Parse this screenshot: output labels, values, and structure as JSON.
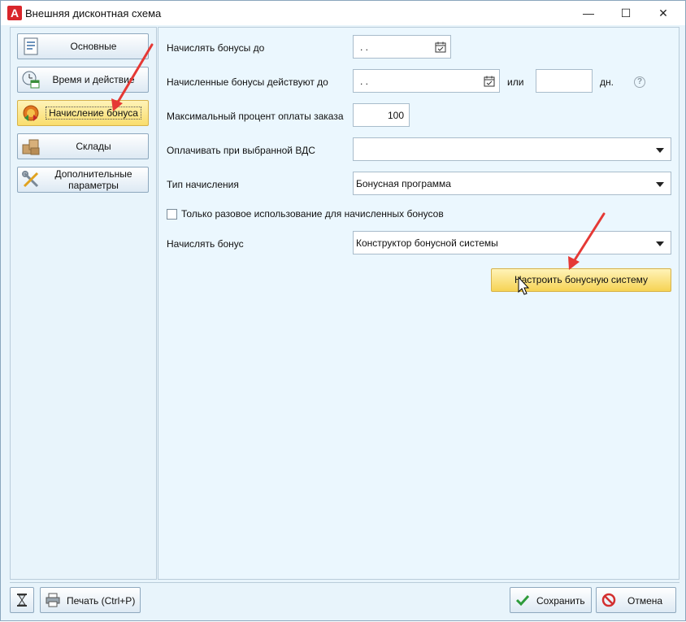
{
  "window": {
    "title": "Внешняя дисконтная схема",
    "icon_letter": "A",
    "minimize_glyph": "—",
    "maximize_glyph": "☐",
    "close_glyph": "✕"
  },
  "sidebar": {
    "items": [
      {
        "label": "Основные",
        "icon": "document-icon",
        "active": false
      },
      {
        "label": "Время и действие",
        "icon": "clock-calendar-icon",
        "active": false
      },
      {
        "label": "Начисление бонуса",
        "icon": "bonus-badge-icon",
        "active": true
      },
      {
        "label": "Склады",
        "icon": "boxes-icon",
        "active": false
      },
      {
        "label": "Дополнительные параметры",
        "icon": "tools-icon",
        "active": false
      }
    ]
  },
  "form": {
    "accrue_until_label": "Начислять бонусы до",
    "accrue_until_value": ". .",
    "valid_until_label": "Начисленные бонусы действуют до",
    "valid_until_value": ". .",
    "or_label": "или",
    "days_value": "",
    "days_unit": "дн.",
    "help_glyph": "?",
    "max_percent_label": "Максимальный процент оплаты заказа",
    "max_percent_value": "100",
    "pay_vds_label": "Оплачивать при выбранной ВДС",
    "pay_vds_value": "",
    "accrual_type_label": "Тип начисления",
    "accrual_type_value": "Бонусная программа",
    "one_time_label": "Только разовое использование для начисленных бонусов",
    "one_time_checked": false,
    "accrue_bonus_label": "Начислять бонус",
    "accrue_bonus_value": "Конструктор бонусной системы",
    "configure_button": "Настроить бонусную систему"
  },
  "footer": {
    "print_label": "Печать (Ctrl+P)",
    "save_label": "Сохранить",
    "cancel_label": "Отмена"
  },
  "colors": {
    "accent_yellow": "#f9dd6d",
    "panel_bg": "#ebf7fe",
    "annotation_arrow": "#e53935"
  }
}
